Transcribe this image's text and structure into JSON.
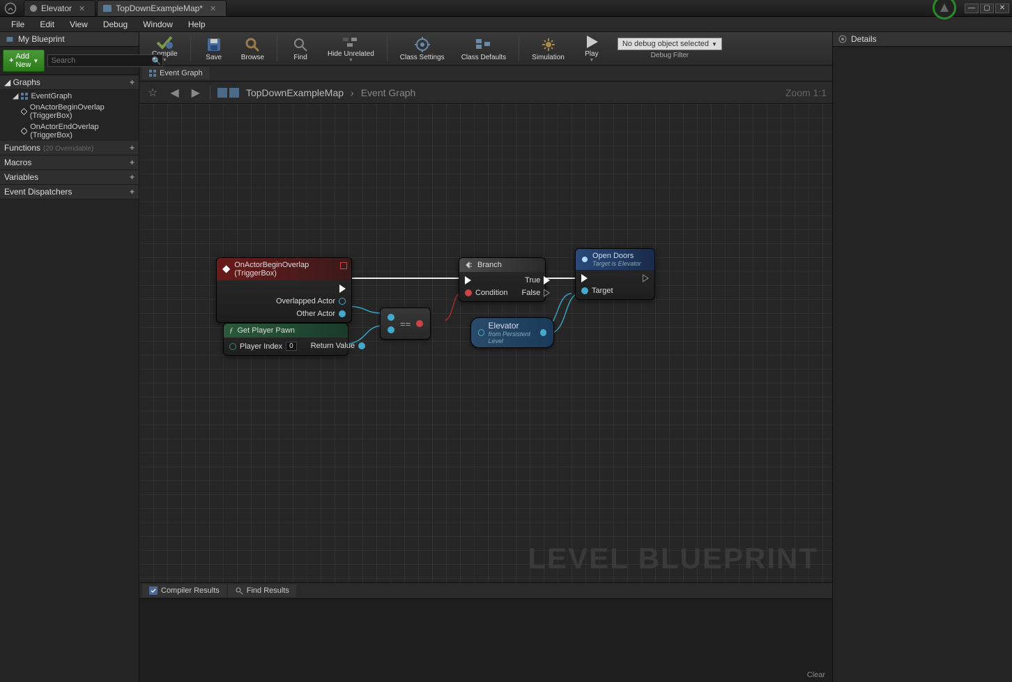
{
  "titlebar": {
    "tabs": [
      {
        "label": "Elevator"
      },
      {
        "label": "TopDownExampleMap*"
      }
    ]
  },
  "menu": [
    "File",
    "Edit",
    "View",
    "Debug",
    "Window",
    "Help"
  ],
  "left": {
    "title": "My Blueprint",
    "addnew": "Add New",
    "search_placeholder": "Search",
    "graphs": "Graphs",
    "eventgraph": "EventGraph",
    "ev1": "OnActorBeginOverlap (TriggerBox)",
    "ev2": "OnActorEndOverlap (TriggerBox)",
    "functions": "Functions",
    "functions_sub": "(20 Overridable)",
    "macros": "Macros",
    "variables": "Variables",
    "dispatchers": "Event Dispatchers"
  },
  "toolbar": {
    "compile": "Compile",
    "save": "Save",
    "browse": "Browse",
    "find": "Find",
    "hide": "Hide Unrelated",
    "class_settings": "Class Settings",
    "class_defaults": "Class Defaults",
    "simulation": "Simulation",
    "play": "Play",
    "debug_select": "No debug object selected",
    "debug_filter": "Debug Filter"
  },
  "graph": {
    "tab": "Event Graph",
    "crumb1": "TopDownExampleMap",
    "crumb2": "Event Graph",
    "zoom": "Zoom 1:1",
    "watermark": "LEVEL BLUEPRINT"
  },
  "nodes": {
    "begin_overlap": "OnActorBeginOverlap (TriggerBox)",
    "overlapped_actor": "Overlapped Actor",
    "other_actor": "Other Actor",
    "get_pawn": "Get Player Pawn",
    "player_index": "Player Index",
    "player_index_val": "0",
    "return_value": "Return Value",
    "equals": "==",
    "branch": "Branch",
    "condition": "Condition",
    "true": "True",
    "false": "False",
    "elevator": "Elevator",
    "elevator_sub": "from Persistent Level",
    "open_doors": "Open Doors",
    "open_doors_sub": "Target is Elevator",
    "target": "Target"
  },
  "bottom": {
    "compiler": "Compiler Results",
    "find": "Find Results",
    "clear": "Clear"
  },
  "right": {
    "title": "Details"
  }
}
